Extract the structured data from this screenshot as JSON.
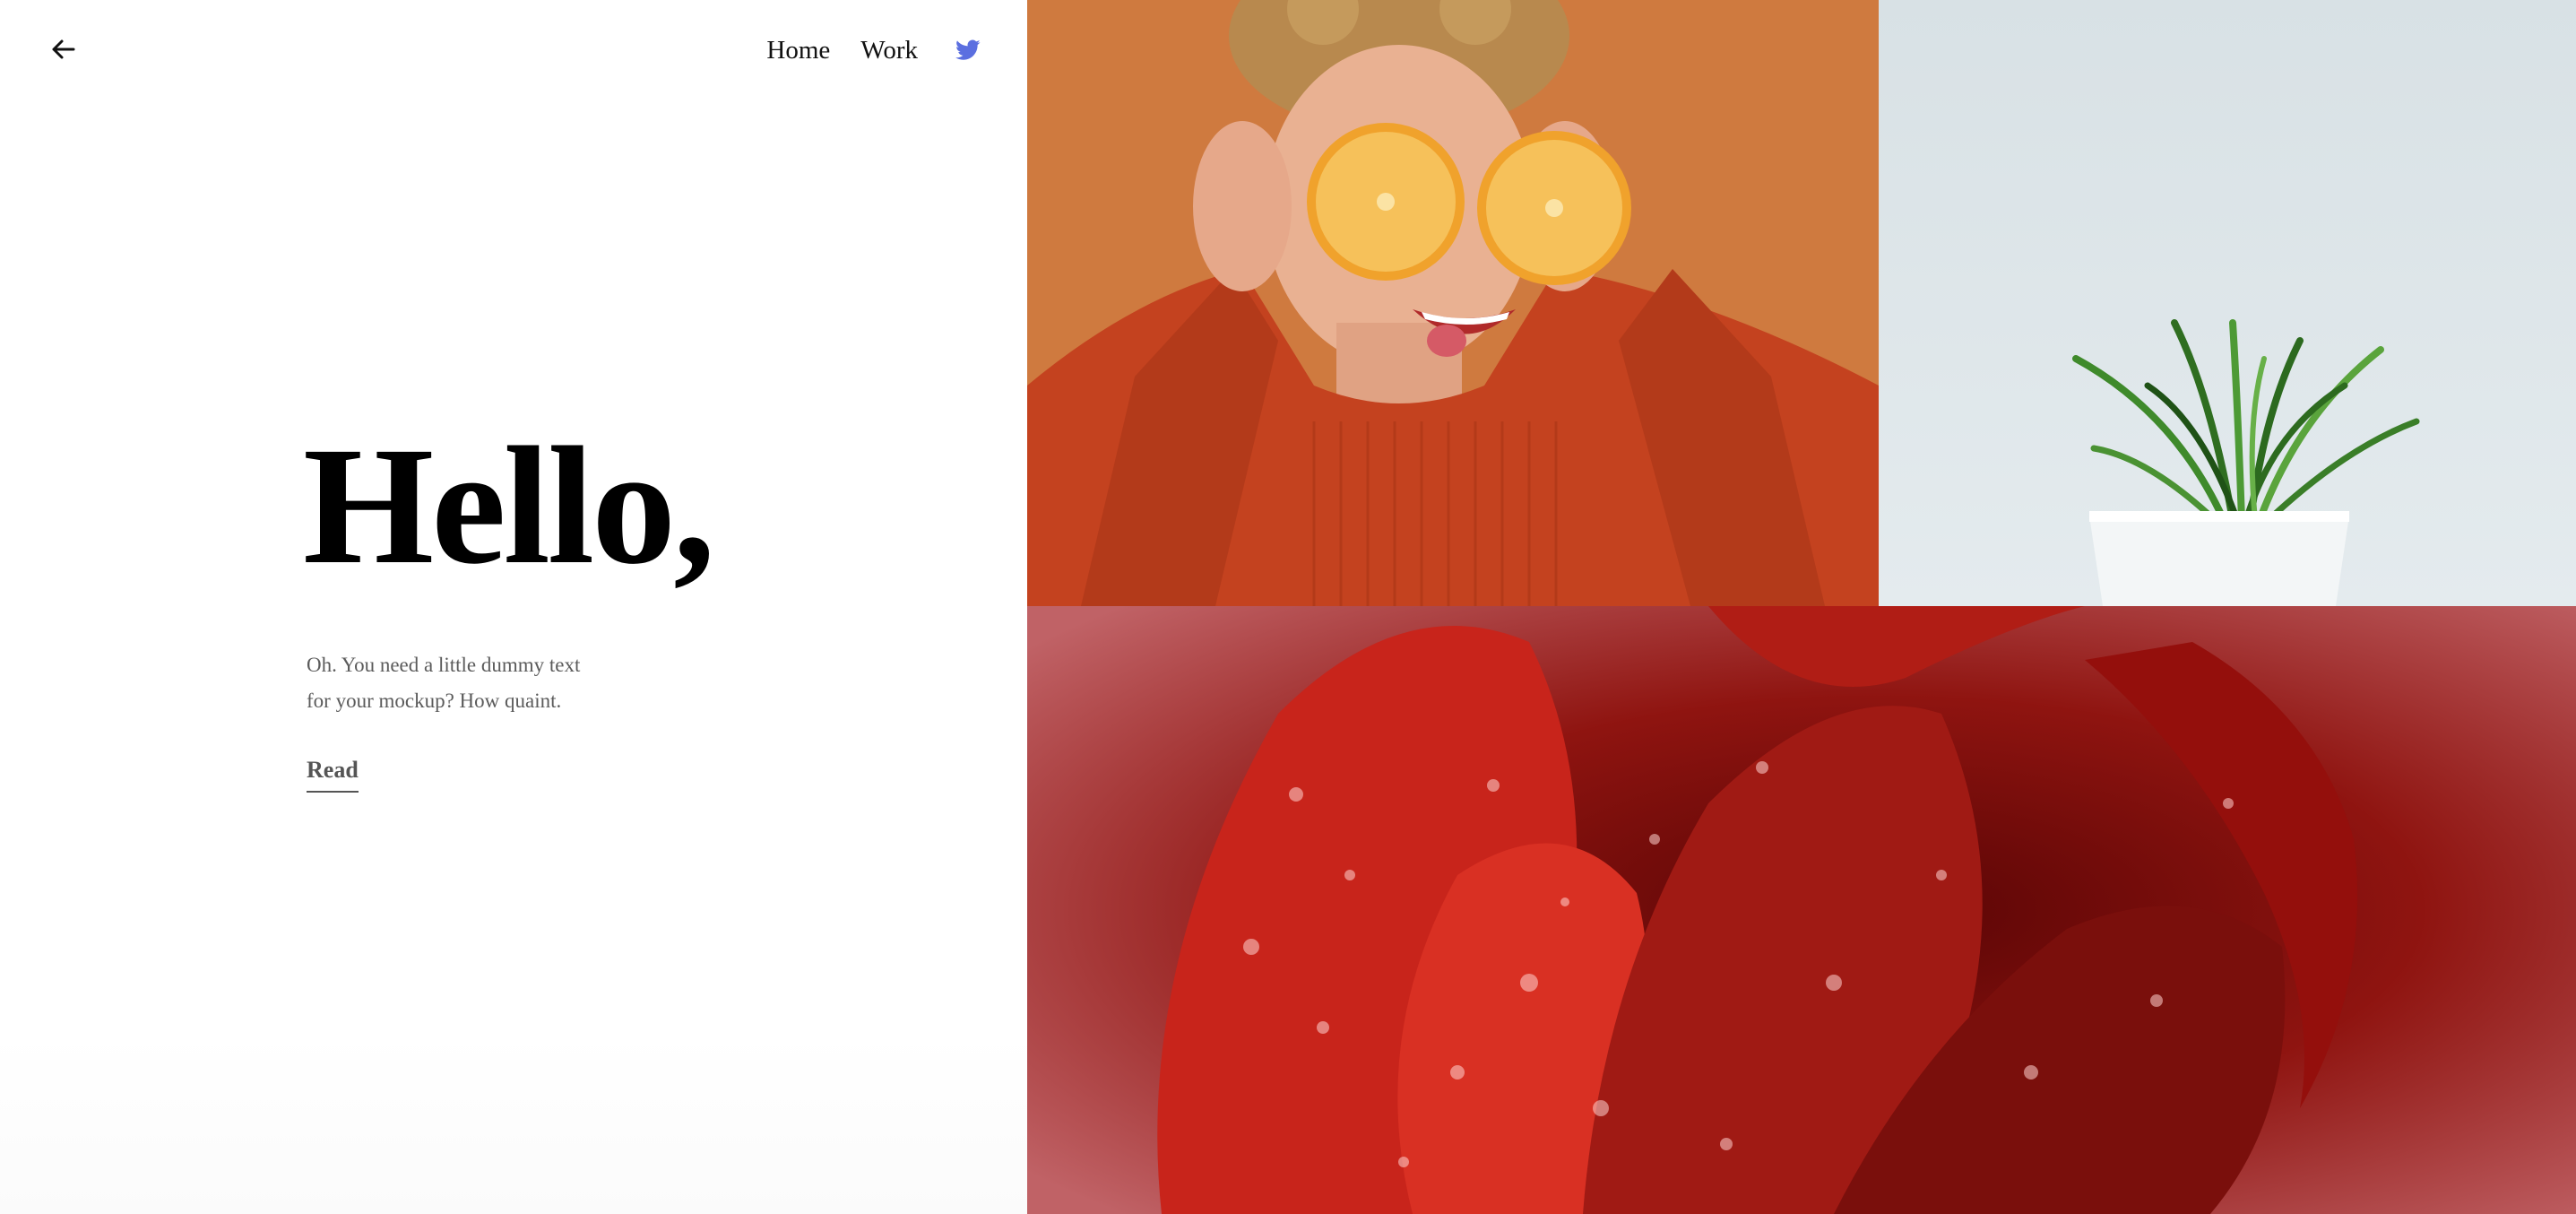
{
  "nav": {
    "home_label": "Home",
    "work_label": "Work",
    "twitter_icon": "twitter-icon",
    "twitter_color": "#5b6fe0"
  },
  "hero": {
    "title": "Hello,",
    "text_line1": "Oh. You need a little dummy text",
    "text_line2": "for your mockup? How quaint.",
    "read_label": "Read"
  },
  "icons": {
    "back": "arrow-left-icon"
  },
  "gallery": {
    "images": [
      "woman-with-oranges-photo",
      "potted-plant-photo",
      "red-rose-photo"
    ]
  },
  "colors": {
    "text_primary": "#000000",
    "text_muted": "#5b5b5b"
  }
}
